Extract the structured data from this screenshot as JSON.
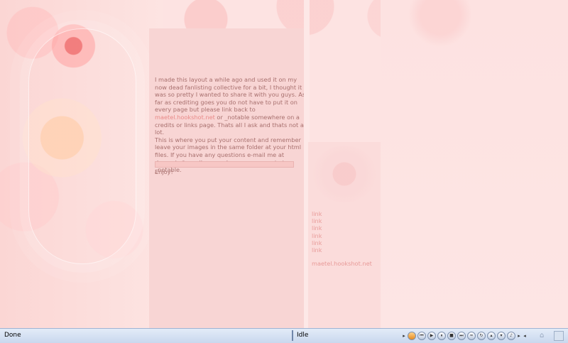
{
  "content": {
    "paragraph1_a": "I made this layout a while ago and used it on my now dead fanlisting collective for a bit, I thought it was so pretty I wanted to share it with you guys. As far as crediting goes you do not have to put it on every page but please link back to ",
    "paragraph1_link": "maetel.hookshot.net",
    "paragraph1_b": " or _notable somewhere on a credits or links page. Thats all I ask and thats not a lot.",
    "paragraph2": "This is where you put your content and remember leave your images in the same folder at your html files. If you have any questions e-mail me at devonrin@gmail.com or leave a comment at _notable.",
    "enjoy": "Enjoy!"
  },
  "nav": {
    "links": [
      "link",
      "link",
      "link",
      "link",
      "link",
      "link"
    ],
    "site_link": "maetel.hookshot.net"
  },
  "statusbar": {
    "left": "Done",
    "middle": "Idle"
  },
  "colors": {
    "background": "#fde3e2",
    "content_column": "#f8d5d4",
    "text": "#a8706e",
    "link": "#e89b99"
  }
}
